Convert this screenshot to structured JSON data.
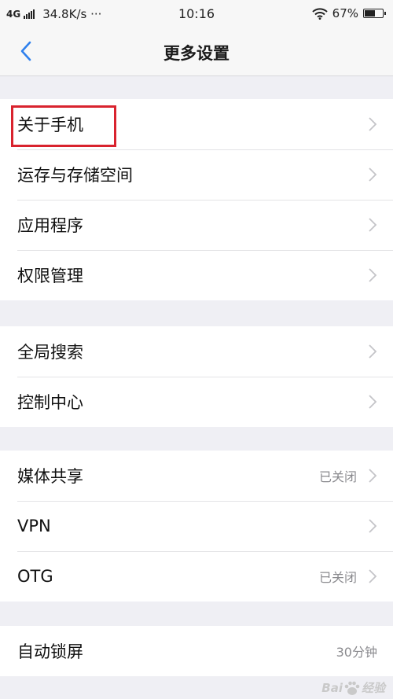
{
  "status_bar": {
    "network": "4G",
    "speed": "34.8K/s ···",
    "time": "10:16",
    "battery": "67%",
    "battery_level": 0.67
  },
  "nav": {
    "title": "更多设置"
  },
  "groups": [
    {
      "items": [
        {
          "label": "关于手机",
          "value": ""
        },
        {
          "label": "运存与存储空间",
          "value": ""
        },
        {
          "label": "应用程序",
          "value": ""
        },
        {
          "label": "权限管理",
          "value": ""
        }
      ]
    },
    {
      "items": [
        {
          "label": "全局搜索",
          "value": ""
        },
        {
          "label": "控制中心",
          "value": ""
        }
      ]
    },
    {
      "items": [
        {
          "label": "媒体共享",
          "value": "已关闭"
        },
        {
          "label": "VPN",
          "value": ""
        },
        {
          "label": "OTG",
          "value": "已关闭"
        }
      ]
    },
    {
      "items": [
        {
          "label": "自动锁屏",
          "value": "30分钟"
        }
      ]
    }
  ],
  "watermark": {
    "text_left": "Bai",
    "text_right": "经验"
  },
  "colors": {
    "accent": "#2f80ed",
    "highlight": "#d9232e",
    "background": "#efeff4"
  }
}
